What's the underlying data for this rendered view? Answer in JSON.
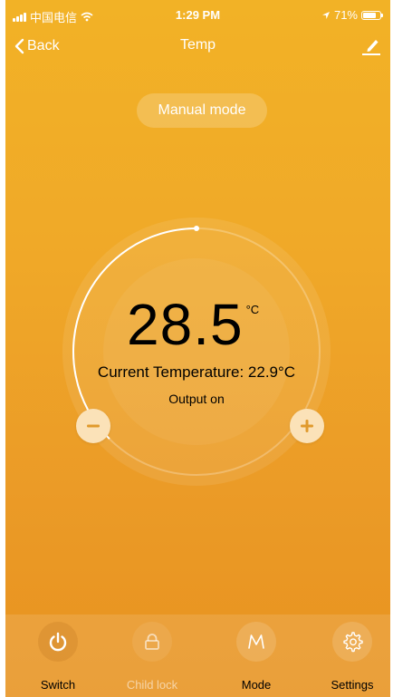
{
  "status_bar": {
    "carrier": "中国电信",
    "time": "1:29 PM",
    "battery": "71%",
    "icons": [
      "signal-icon",
      "wifi-icon",
      "location-arrow-icon",
      "battery-icon"
    ]
  },
  "nav": {
    "back_label": "Back",
    "title": "Temp",
    "icons": [
      "chevron-left-icon",
      "edit-icon"
    ]
  },
  "mode_pill": "Manual mode",
  "thermostat": {
    "setpoint": "28.5",
    "unit": "°C",
    "current_temperature": "Current Temperature: 22.9°C",
    "output_status": "Output on",
    "dial_progress": 0.5,
    "icons": [
      "minus-icon",
      "plus-icon"
    ]
  },
  "bottom_bar": {
    "tabs": [
      {
        "label": "Switch",
        "icon": "power-icon",
        "enabled": true
      },
      {
        "label": "Child lock",
        "icon": "lock-icon",
        "enabled": false
      },
      {
        "label": "Mode",
        "icon": "mode-m-icon",
        "enabled": true
      },
      {
        "label": "Settings",
        "icon": "gear-icon",
        "enabled": true
      }
    ]
  },
  "colors": {
    "background_top": "#f2b226",
    "background_bottom": "#e8921f",
    "button_fill": "#fbe2b8",
    "button_glyph": "#e09a2c"
  }
}
